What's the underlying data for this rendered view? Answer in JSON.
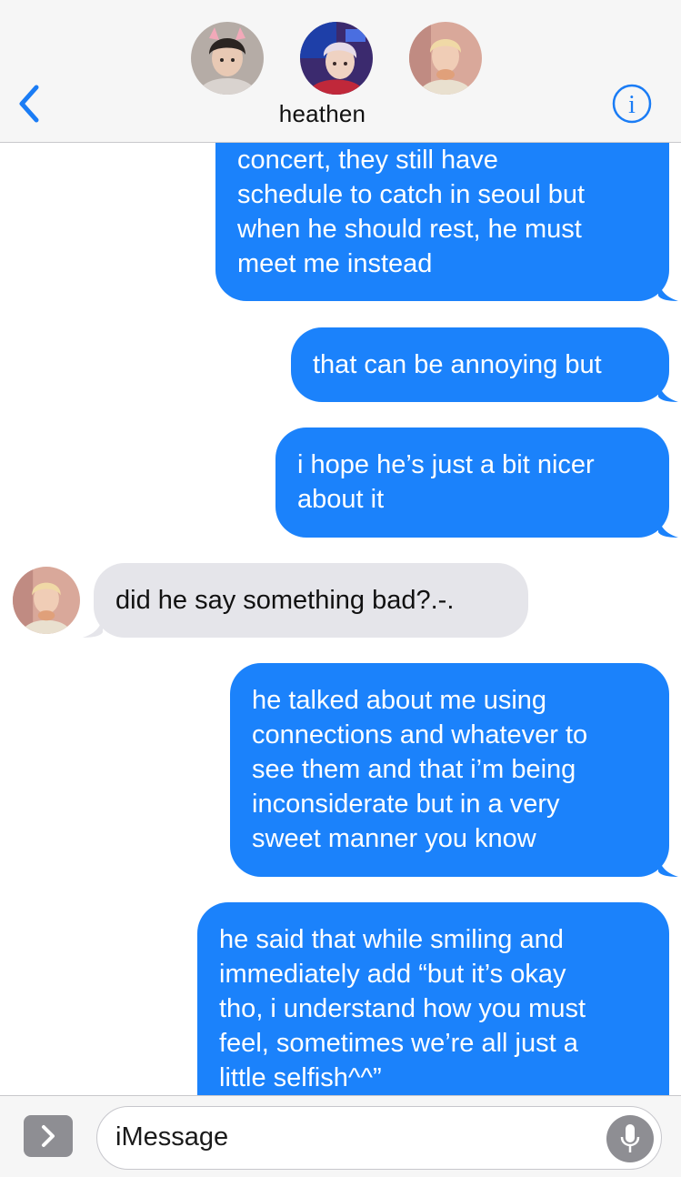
{
  "header": {
    "back_icon": "chevron-left-icon",
    "title": "heathen",
    "info_icon": "info-icon",
    "avatars": [
      "group-member-avatar",
      "group-member-avatar",
      "group-member-avatar"
    ]
  },
  "messages": [
    {
      "direction": "outgoing",
      "lines": [
        "concert, they still have",
        "schedule to catch in seoul but",
        "when he should rest, he must",
        "meet me instead"
      ]
    },
    {
      "direction": "outgoing",
      "lines": [
        "that can be annoying but"
      ]
    },
    {
      "direction": "outgoing",
      "lines": [
        "i hope he’s just a bit nicer",
        "about it"
      ]
    },
    {
      "direction": "incoming",
      "lines": [
        "did he say something bad?.-."
      ]
    },
    {
      "direction": "outgoing",
      "lines": [
        "he talked about me using",
        "connections and whatever to",
        "see them and that i’m being",
        "inconsiderate but in a very",
        "sweet manner you know"
      ]
    },
    {
      "direction": "outgoing",
      "lines": [
        "he said that while smiling and",
        "immediately add “but it’s okay",
        "tho, i understand how you must",
        "feel, sometimes we’re all just a",
        "little selfish^^”"
      ]
    }
  ],
  "input": {
    "expand_icon": "chevron-right-icon",
    "placeholder": "iMessage",
    "mic_icon": "microphone-icon"
  },
  "colors": {
    "outgoing_bubble": "#1b82fb",
    "incoming_bubble": "#e5e5ea",
    "accent": "#1a7cf5"
  }
}
